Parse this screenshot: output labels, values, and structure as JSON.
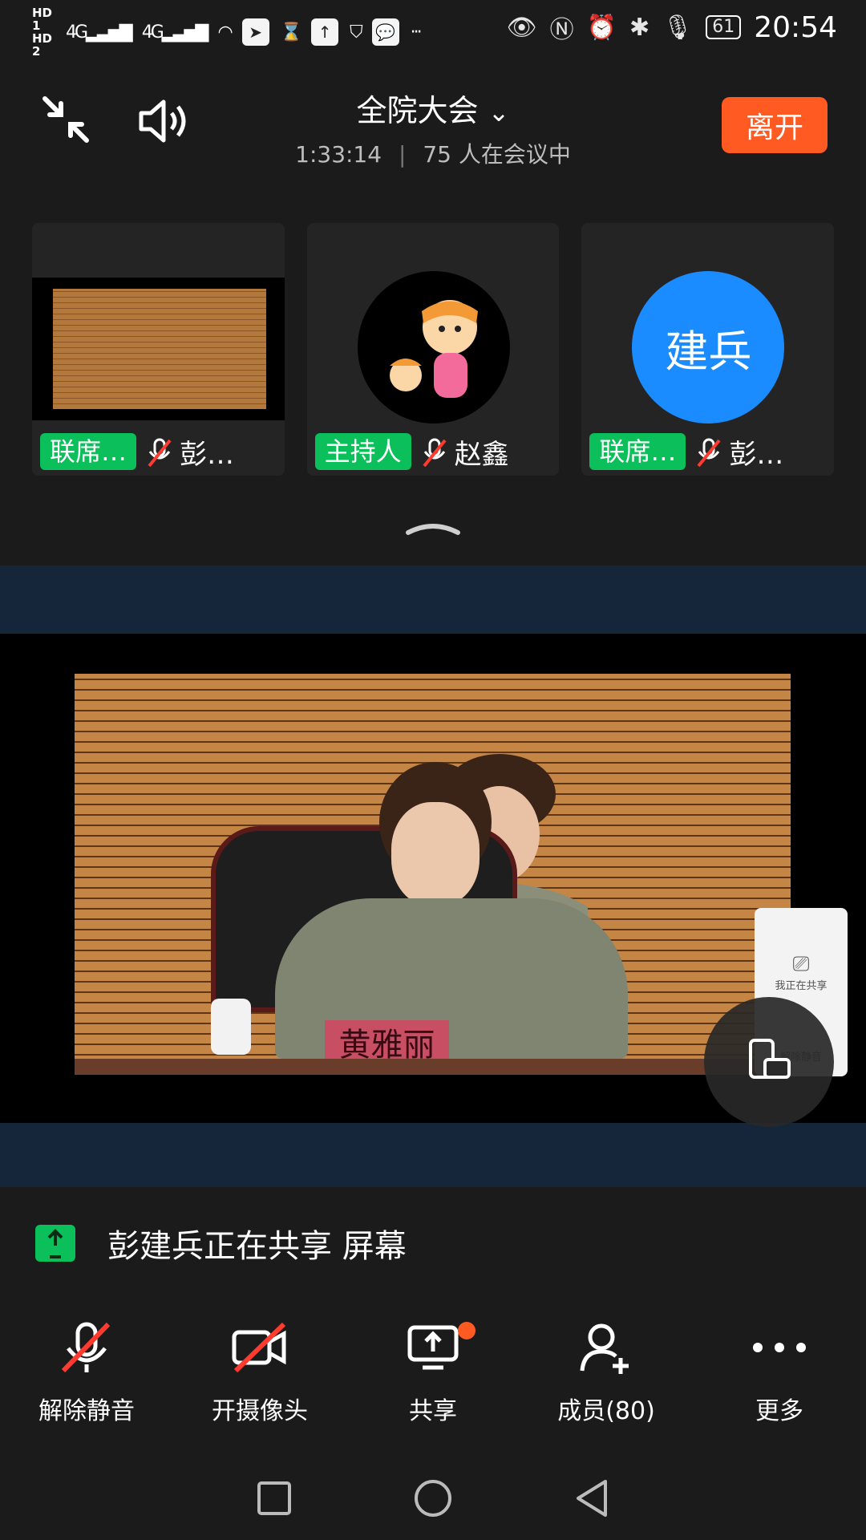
{
  "status_bar": {
    "hd1": "HD 1",
    "hd2": "HD 2",
    "net1": "4G",
    "net2": "4G",
    "battery": "61",
    "time": "20:54"
  },
  "header": {
    "title": "全院大会",
    "elapsed": "1:33:14",
    "participants_text": "75 人在会议中",
    "leave_label": "离开"
  },
  "tiles": [
    {
      "role": "联席…",
      "name": "彭…",
      "type": "video"
    },
    {
      "role": "主持人",
      "name": "赵鑫",
      "type": "avatar-cartoon"
    },
    {
      "role": "联席…",
      "name": "彭…",
      "type": "avatar-text",
      "avatar_text": "建兵",
      "avatar_color": "#1a8cff"
    }
  ],
  "main": {
    "nameplate": "黄雅丽",
    "share_card_text": "我正在共享",
    "share_card_sub": "解除静音"
  },
  "share_notice": {
    "text": "彭建兵正在共享 屏幕"
  },
  "toolbar": {
    "unmute_label": "解除静音",
    "camera_label": "开摄像头",
    "share_label": "共享",
    "members_label": "成员(80)",
    "more_label": "更多"
  },
  "colors": {
    "accent": "#ff5a22",
    "role_badge": "#0bbf5a",
    "avatar_blue": "#1a8cff",
    "background": "#1b1b1b"
  }
}
